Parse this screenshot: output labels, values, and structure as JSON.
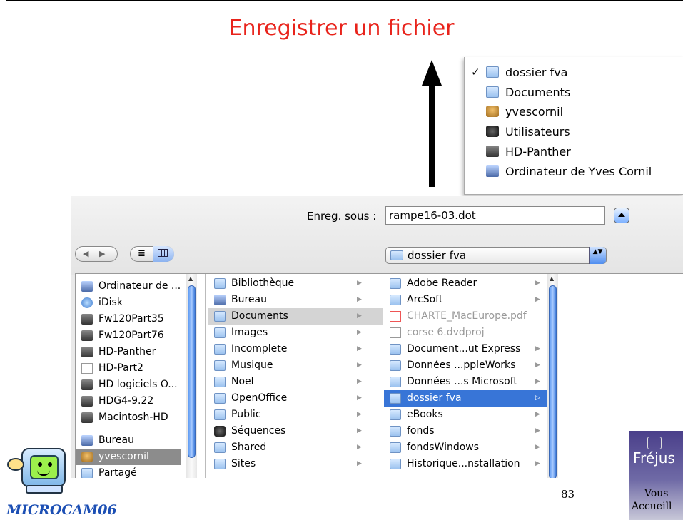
{
  "slide": {
    "title": "Enregistrer un fichier",
    "page_number": "83",
    "title_color": "#e8231b"
  },
  "location_menu": {
    "items": [
      {
        "label": "dossier fva",
        "icon": "folder-icon",
        "checked": true,
        "check": "✓"
      },
      {
        "label": "Documents",
        "icon": "documents-folder-icon",
        "checked": false
      },
      {
        "label": "yvescornil",
        "icon": "home-user-icon",
        "checked": false
      },
      {
        "label": "Utilisateurs",
        "icon": "users-folder-icon",
        "checked": false
      },
      {
        "label": "HD-Panther",
        "icon": "hard-drive-icon",
        "checked": false
      },
      {
        "label": "Ordinateur de Yves Cornil",
        "icon": "computer-icon",
        "checked": false
      }
    ]
  },
  "dialog": {
    "save_as_label": "Enreg. sous :",
    "save_as_value": "rampe16-03.dot",
    "location_value": "dossier fva",
    "nav_back": "◀",
    "nav_forward": "▶",
    "view_list": "≣",
    "popup_arrows": "▲▼",
    "expand_arrow": "▲"
  },
  "sidebar": {
    "devices": [
      {
        "label": "Ordinateur de ...",
        "icon": "computer-icon"
      },
      {
        "label": "iDisk",
        "icon": "idisk-icon"
      },
      {
        "label": "Fw120Part35",
        "icon": "firewire-drive-icon"
      },
      {
        "label": "Fw120Part76",
        "icon": "firewire-drive-icon"
      },
      {
        "label": "HD-Panther",
        "icon": "hard-drive-icon"
      },
      {
        "label": "HD-Part2",
        "icon": "removable-drive-icon"
      },
      {
        "label": "HD logiciels O...",
        "icon": "drive-icon"
      },
      {
        "label": "HDG4-9.22",
        "icon": "drive-icon"
      },
      {
        "label": "Macintosh-HD",
        "icon": "drive-icon"
      }
    ],
    "places": [
      {
        "label": "Bureau",
        "icon": "desktop-icon",
        "selected": false
      },
      {
        "label": "yvescornil",
        "icon": "home-user-icon",
        "selected": true
      },
      {
        "label": "Partagé",
        "icon": "folder-icon",
        "selected": false
      }
    ]
  },
  "column1": {
    "items": [
      {
        "label": "Bibliothèque",
        "icon": "library-folder-icon",
        "selected": false
      },
      {
        "label": "Bureau",
        "icon": "desktop-folder-icon",
        "selected": false
      },
      {
        "label": "Documents",
        "icon": "documents-folder-icon",
        "selected": true
      },
      {
        "label": "Images",
        "icon": "pictures-folder-icon",
        "selected": false
      },
      {
        "label": "Incomplete",
        "icon": "folder-icon",
        "selected": false
      },
      {
        "label": "Musique",
        "icon": "music-folder-icon",
        "selected": false
      },
      {
        "label": "Noel",
        "icon": "folder-icon",
        "selected": false
      },
      {
        "label": "OpenOffice",
        "icon": "folder-icon",
        "selected": false
      },
      {
        "label": "Public",
        "icon": "public-folder-icon",
        "selected": false
      },
      {
        "label": "Séquences",
        "icon": "movies-folder-icon",
        "selected": false
      },
      {
        "label": "Shared",
        "icon": "folder-icon",
        "selected": false
      },
      {
        "label": "Sites",
        "icon": "sites-folder-icon",
        "selected": false
      }
    ]
  },
  "column2": {
    "items": [
      {
        "label": "Adobe Reader",
        "icon": "folder-icon",
        "selected": false,
        "disabled": false
      },
      {
        "label": "ArcSoft",
        "icon": "folder-icon",
        "selected": false,
        "disabled": false
      },
      {
        "label": "CHARTE_MacEurope.pdf",
        "icon": "pdf-file-icon",
        "selected": false,
        "disabled": true
      },
      {
        "label": "corse 6.dvdproj",
        "icon": "dvd-project-file-icon",
        "selected": false,
        "disabled": true
      },
      {
        "label": "Document...ut Express",
        "icon": "folder-icon",
        "selected": false,
        "disabled": false
      },
      {
        "label": "Données ...ppleWorks",
        "icon": "folder-icon",
        "selected": false,
        "disabled": false
      },
      {
        "label": "Données ...s Microsoft",
        "icon": "folder-icon",
        "selected": false,
        "disabled": false
      },
      {
        "label": "dossier fva",
        "icon": "folder-icon",
        "selected": true,
        "disabled": false
      },
      {
        "label": "eBooks",
        "icon": "folder-icon",
        "selected": false,
        "disabled": false
      },
      {
        "label": "fonds",
        "icon": "folder-icon",
        "selected": false,
        "disabled": false
      },
      {
        "label": "fondsWindows",
        "icon": "folder-icon",
        "selected": false,
        "disabled": false
      },
      {
        "label": "Historique...nstallation",
        "icon": "folder-icon",
        "selected": false,
        "disabled": false
      }
    ]
  },
  "branding": {
    "left_logo_text": "MICROCAM06",
    "right_logo_city": "Fréjus",
    "right_logo_line1": "Vous",
    "right_logo_line2": "Accueill",
    "brand_color": "#1c4fb4"
  }
}
